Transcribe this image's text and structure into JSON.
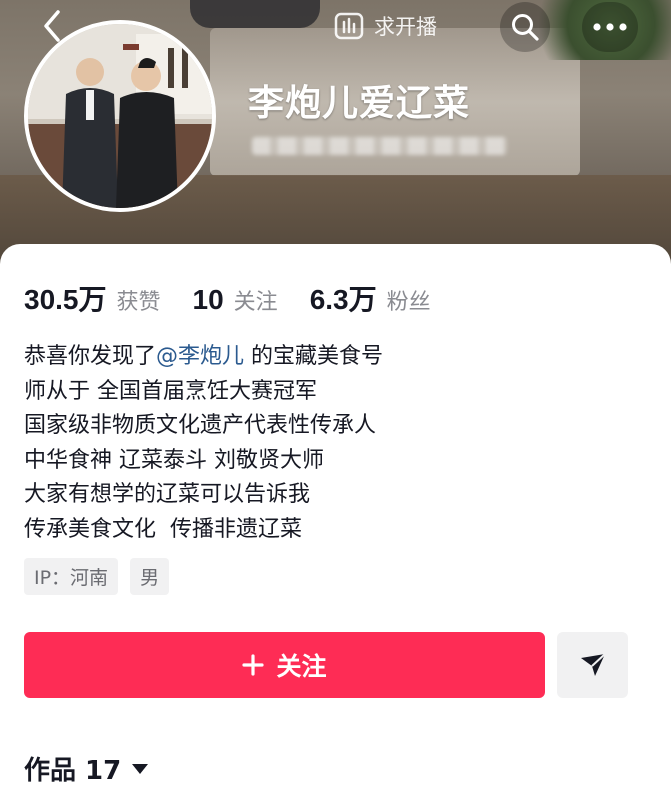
{
  "header": {
    "live_request_label": "求开播",
    "nickname": "李炮儿爱辽菜"
  },
  "stats": [
    {
      "value": "30.5万",
      "label": "获赞"
    },
    {
      "value": "10",
      "label": "关注"
    },
    {
      "value": "6.3万",
      "label": "粉丝"
    }
  ],
  "bio": {
    "line1_prefix": "恭喜你发现了",
    "line1_mention": "@李炮儿",
    "line1_suffix": " 的宝藏美食号",
    "line2": "师从于 全国首届烹饪大赛冠军",
    "line3": "国家级非物质文化遗产代表性传承人",
    "line4": "中华食神 辽菜泰斗 刘敬贤大师",
    "line5": "大家有想学的辽菜可以告诉我",
    "line6": "传承美食文化  传播非遗辽菜"
  },
  "tags": {
    "ip": "IP：河南",
    "gender": "男"
  },
  "actions": {
    "follow_label": "关注"
  },
  "tabs": {
    "works_label": "作品 17"
  },
  "colors": {
    "accent": "#fe2c55",
    "mention": "#2b5a8f"
  },
  "icons": [
    "back-arrow-icon",
    "live-request-icon",
    "search-icon",
    "more-icon",
    "plus-icon",
    "send-icon",
    "caret-down-icon"
  ]
}
